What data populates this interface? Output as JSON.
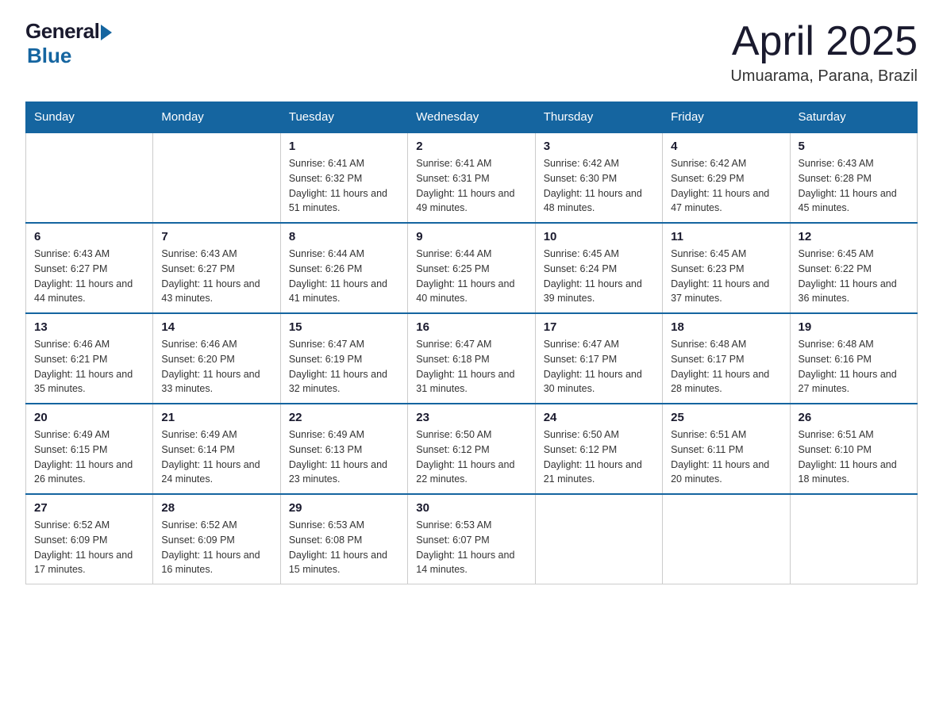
{
  "header": {
    "logo_general": "General",
    "logo_blue": "Blue",
    "month_title": "April 2025",
    "location": "Umuarama, Parana, Brazil"
  },
  "weekdays": [
    "Sunday",
    "Monday",
    "Tuesday",
    "Wednesday",
    "Thursday",
    "Friday",
    "Saturday"
  ],
  "weeks": [
    [
      {
        "day": "",
        "sunrise": "",
        "sunset": "",
        "daylight": ""
      },
      {
        "day": "",
        "sunrise": "",
        "sunset": "",
        "daylight": ""
      },
      {
        "day": "1",
        "sunrise": "Sunrise: 6:41 AM",
        "sunset": "Sunset: 6:32 PM",
        "daylight": "Daylight: 11 hours and 51 minutes."
      },
      {
        "day": "2",
        "sunrise": "Sunrise: 6:41 AM",
        "sunset": "Sunset: 6:31 PM",
        "daylight": "Daylight: 11 hours and 49 minutes."
      },
      {
        "day": "3",
        "sunrise": "Sunrise: 6:42 AM",
        "sunset": "Sunset: 6:30 PM",
        "daylight": "Daylight: 11 hours and 48 minutes."
      },
      {
        "day": "4",
        "sunrise": "Sunrise: 6:42 AM",
        "sunset": "Sunset: 6:29 PM",
        "daylight": "Daylight: 11 hours and 47 minutes."
      },
      {
        "day": "5",
        "sunrise": "Sunrise: 6:43 AM",
        "sunset": "Sunset: 6:28 PM",
        "daylight": "Daylight: 11 hours and 45 minutes."
      }
    ],
    [
      {
        "day": "6",
        "sunrise": "Sunrise: 6:43 AM",
        "sunset": "Sunset: 6:27 PM",
        "daylight": "Daylight: 11 hours and 44 minutes."
      },
      {
        "day": "7",
        "sunrise": "Sunrise: 6:43 AM",
        "sunset": "Sunset: 6:27 PM",
        "daylight": "Daylight: 11 hours and 43 minutes."
      },
      {
        "day": "8",
        "sunrise": "Sunrise: 6:44 AM",
        "sunset": "Sunset: 6:26 PM",
        "daylight": "Daylight: 11 hours and 41 minutes."
      },
      {
        "day": "9",
        "sunrise": "Sunrise: 6:44 AM",
        "sunset": "Sunset: 6:25 PM",
        "daylight": "Daylight: 11 hours and 40 minutes."
      },
      {
        "day": "10",
        "sunrise": "Sunrise: 6:45 AM",
        "sunset": "Sunset: 6:24 PM",
        "daylight": "Daylight: 11 hours and 39 minutes."
      },
      {
        "day": "11",
        "sunrise": "Sunrise: 6:45 AM",
        "sunset": "Sunset: 6:23 PM",
        "daylight": "Daylight: 11 hours and 37 minutes."
      },
      {
        "day": "12",
        "sunrise": "Sunrise: 6:45 AM",
        "sunset": "Sunset: 6:22 PM",
        "daylight": "Daylight: 11 hours and 36 minutes."
      }
    ],
    [
      {
        "day": "13",
        "sunrise": "Sunrise: 6:46 AM",
        "sunset": "Sunset: 6:21 PM",
        "daylight": "Daylight: 11 hours and 35 minutes."
      },
      {
        "day": "14",
        "sunrise": "Sunrise: 6:46 AM",
        "sunset": "Sunset: 6:20 PM",
        "daylight": "Daylight: 11 hours and 33 minutes."
      },
      {
        "day": "15",
        "sunrise": "Sunrise: 6:47 AM",
        "sunset": "Sunset: 6:19 PM",
        "daylight": "Daylight: 11 hours and 32 minutes."
      },
      {
        "day": "16",
        "sunrise": "Sunrise: 6:47 AM",
        "sunset": "Sunset: 6:18 PM",
        "daylight": "Daylight: 11 hours and 31 minutes."
      },
      {
        "day": "17",
        "sunrise": "Sunrise: 6:47 AM",
        "sunset": "Sunset: 6:17 PM",
        "daylight": "Daylight: 11 hours and 30 minutes."
      },
      {
        "day": "18",
        "sunrise": "Sunrise: 6:48 AM",
        "sunset": "Sunset: 6:17 PM",
        "daylight": "Daylight: 11 hours and 28 minutes."
      },
      {
        "day": "19",
        "sunrise": "Sunrise: 6:48 AM",
        "sunset": "Sunset: 6:16 PM",
        "daylight": "Daylight: 11 hours and 27 minutes."
      }
    ],
    [
      {
        "day": "20",
        "sunrise": "Sunrise: 6:49 AM",
        "sunset": "Sunset: 6:15 PM",
        "daylight": "Daylight: 11 hours and 26 minutes."
      },
      {
        "day": "21",
        "sunrise": "Sunrise: 6:49 AM",
        "sunset": "Sunset: 6:14 PM",
        "daylight": "Daylight: 11 hours and 24 minutes."
      },
      {
        "day": "22",
        "sunrise": "Sunrise: 6:49 AM",
        "sunset": "Sunset: 6:13 PM",
        "daylight": "Daylight: 11 hours and 23 minutes."
      },
      {
        "day": "23",
        "sunrise": "Sunrise: 6:50 AM",
        "sunset": "Sunset: 6:12 PM",
        "daylight": "Daylight: 11 hours and 22 minutes."
      },
      {
        "day": "24",
        "sunrise": "Sunrise: 6:50 AM",
        "sunset": "Sunset: 6:12 PM",
        "daylight": "Daylight: 11 hours and 21 minutes."
      },
      {
        "day": "25",
        "sunrise": "Sunrise: 6:51 AM",
        "sunset": "Sunset: 6:11 PM",
        "daylight": "Daylight: 11 hours and 20 minutes."
      },
      {
        "day": "26",
        "sunrise": "Sunrise: 6:51 AM",
        "sunset": "Sunset: 6:10 PM",
        "daylight": "Daylight: 11 hours and 18 minutes."
      }
    ],
    [
      {
        "day": "27",
        "sunrise": "Sunrise: 6:52 AM",
        "sunset": "Sunset: 6:09 PM",
        "daylight": "Daylight: 11 hours and 17 minutes."
      },
      {
        "day": "28",
        "sunrise": "Sunrise: 6:52 AM",
        "sunset": "Sunset: 6:09 PM",
        "daylight": "Daylight: 11 hours and 16 minutes."
      },
      {
        "day": "29",
        "sunrise": "Sunrise: 6:53 AM",
        "sunset": "Sunset: 6:08 PM",
        "daylight": "Daylight: 11 hours and 15 minutes."
      },
      {
        "day": "30",
        "sunrise": "Sunrise: 6:53 AM",
        "sunset": "Sunset: 6:07 PM",
        "daylight": "Daylight: 11 hours and 14 minutes."
      },
      {
        "day": "",
        "sunrise": "",
        "sunset": "",
        "daylight": ""
      },
      {
        "day": "",
        "sunrise": "",
        "sunset": "",
        "daylight": ""
      },
      {
        "day": "",
        "sunrise": "",
        "sunset": "",
        "daylight": ""
      }
    ]
  ]
}
